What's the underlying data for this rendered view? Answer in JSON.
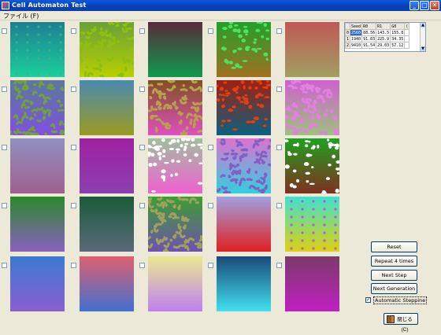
{
  "window": {
    "title": "Cell Automaton Test",
    "min_glyph": "_",
    "max_glyph": "□",
    "close_glyph": "✕"
  },
  "menu": {
    "file": "ファイル (F)"
  },
  "table": {
    "headers": [
      "",
      "Seed",
      "R0",
      "R1",
      "G0",
      "("
    ],
    "rows": [
      [
        "0",
        "2560",
        "88.56",
        "143.5",
        "155.8",
        ""
      ],
      [
        "1",
        "1940",
        "91.03",
        "225.9",
        "34.35",
        ""
      ],
      [
        "2",
        "9410",
        "91.54",
        "29.03",
        "57.12",
        ""
      ]
    ]
  },
  "buttons": {
    "reset": "Reset",
    "repeat": "Repeat 4 times",
    "next_step": "Next Step",
    "next_generation": "Next Generation",
    "close": "閉じる(C)"
  },
  "auto_stepping": {
    "label": "Automatic Steppine",
    "checked": true
  },
  "cells": [
    {
      "top": "#1f7f8f",
      "bottom": "#1acf9e",
      "fg": "#40b090",
      "pattern": "dots"
    },
    {
      "top": "#6aa03a",
      "bottom": "#b8d000",
      "fg": "#8fc010",
      "pattern": "blobs"
    },
    {
      "top": "#5a2a3a",
      "bottom": "#0f9a50",
      "fg": null,
      "pattern": "none"
    },
    {
      "top": "#22a02a",
      "bottom": "#a07020",
      "fg": "#50e060",
      "pattern": "spots"
    },
    {
      "top": "#c05858",
      "bottom": "#a0a060",
      "fg": "#d87070",
      "pattern": "none"
    },
    {
      "top": "#5a7a9a",
      "bottom": "#8050e0",
      "fg": "#70a040",
      "pattern": "blobs"
    },
    {
      "top": "#4a8ab0",
      "bottom": "#9a9a20",
      "fg": null,
      "pattern": "none"
    },
    {
      "top": "#805020",
      "bottom": "#e050c0",
      "fg": "#b8a050",
      "pattern": "blobs"
    },
    {
      "top": "#a02010",
      "bottom": "#0a6080",
      "fg": "#e04010",
      "pattern": "spots"
    },
    {
      "top": "#d060d0",
      "bottom": "#a0c080",
      "fg": "#e080e0",
      "pattern": "blobs"
    },
    {
      "top": "#9090c0",
      "bottom": "#a06090",
      "fg": null,
      "pattern": "none"
    },
    {
      "top": "#a020a0",
      "bottom": "#8a40b0",
      "fg": null,
      "pattern": "none"
    },
    {
      "top": "#a0c0a0",
      "bottom": "#f060d0",
      "fg": "#ffffff",
      "pattern": "spots"
    },
    {
      "top": "#e070d0",
      "bottom": "#30d0e0",
      "fg": "#8060c0",
      "pattern": "blobs"
    },
    {
      "top": "#20a020",
      "bottom": "#803020",
      "fg": "#ffffff",
      "pattern": "spots"
    },
    {
      "top": "#2a8a2a",
      "bottom": "#8a60c0",
      "fg": null,
      "pattern": "none"
    },
    {
      "top": "#1a5a3a",
      "bottom": "#5a6a7a",
      "fg": null,
      "pattern": "none"
    },
    {
      "top": "#3aa030",
      "bottom": "#7050b0",
      "fg": "#a0a060",
      "pattern": "blobs"
    },
    {
      "top": "#a0a0e0",
      "bottom": "#e02020",
      "fg": null,
      "pattern": "none"
    },
    {
      "top": "#40e0d0",
      "bottom": "#e0d010",
      "fg": "#a060c0",
      "pattern": "dots"
    },
    {
      "top": "#3a7ad0",
      "bottom": "#8a60d0",
      "fg": null,
      "pattern": "none"
    },
    {
      "top": "#e06070",
      "bottom": "#4070d0",
      "fg": null,
      "pattern": "none"
    },
    {
      "top": "#e8e890",
      "bottom": "#c080f0",
      "fg": null,
      "pattern": "none"
    },
    {
      "top": "#1a4a7a",
      "bottom": "#40e0f0",
      "fg": null,
      "pattern": "none"
    },
    {
      "top": "#7a3a6a",
      "bottom": "#c020c0",
      "fg": null,
      "pattern": "none"
    }
  ]
}
